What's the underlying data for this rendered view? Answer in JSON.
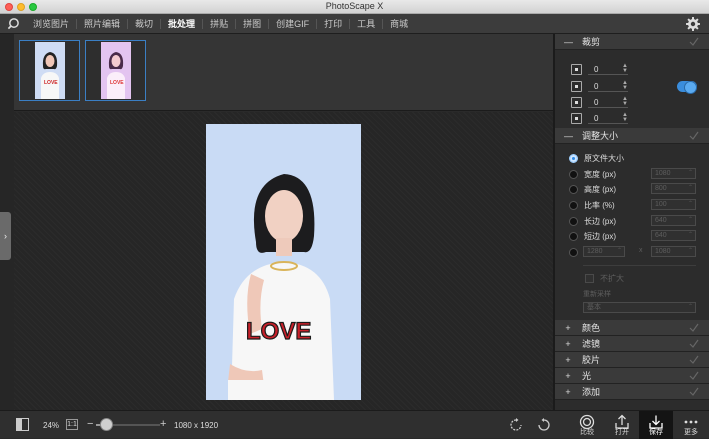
{
  "window": {
    "title": "PhotoScape X"
  },
  "menu": {
    "items": [
      {
        "label": "浏览图片"
      },
      {
        "label": "照片编辑"
      },
      {
        "label": "裁切"
      },
      {
        "label": "批处理",
        "active": true
      },
      {
        "label": "拼贴"
      },
      {
        "label": "拼图"
      },
      {
        "label": "创建GIF"
      },
      {
        "label": "打印"
      },
      {
        "label": "工具"
      },
      {
        "label": "商城"
      }
    ]
  },
  "crop": {
    "title": "裁剪",
    "values": [
      "0",
      "0",
      "0",
      "0"
    ],
    "enabled": true
  },
  "resize": {
    "title": "调整大小",
    "options": [
      {
        "label": "原文件大小",
        "selected": true
      },
      {
        "label": "宽度 (px)",
        "value": "1080"
      },
      {
        "label": "高度 (px)",
        "value": "800"
      },
      {
        "label": "比率 (%)",
        "value": "100"
      },
      {
        "label": "长边 (px)",
        "value": "640"
      },
      {
        "label": "短边 (px)",
        "value": "640"
      }
    ],
    "wh": {
      "w": "1280",
      "x": "x",
      "h": "1080"
    },
    "no_enlarge": "不扩大",
    "resample_label": "重新采样",
    "resample_value": "基本"
  },
  "sections": [
    {
      "label": "颜色"
    },
    {
      "label": "滤镜"
    },
    {
      "label": "胶片"
    },
    {
      "label": "光"
    },
    {
      "label": "添加"
    }
  ],
  "bottom": {
    "zoom": "24%",
    "one_to_one": "1:1",
    "zoom_level": 0.15,
    "dimensions": "1080 x 1920",
    "buttons": [
      {
        "label": "比较"
      },
      {
        "label": "打开"
      },
      {
        "label": "保存"
      },
      {
        "label": "更多"
      }
    ]
  },
  "colors": {
    "accent": "#3b8fe0",
    "selection": "#3b7fc4"
  }
}
